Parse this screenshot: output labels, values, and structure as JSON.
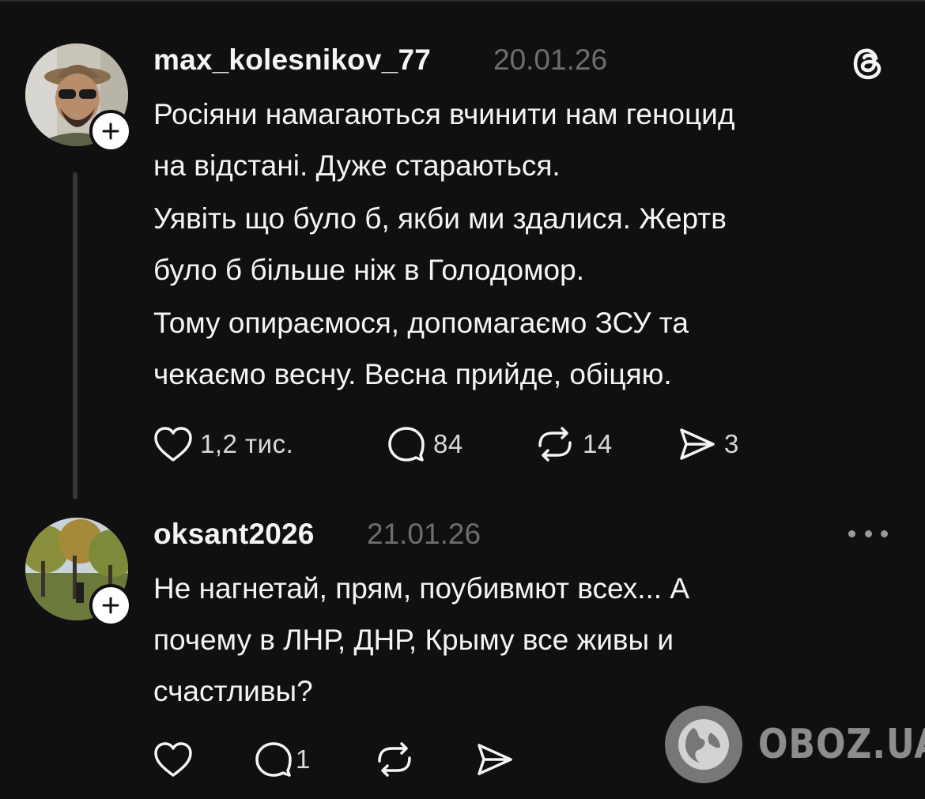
{
  "post1": {
    "username": "max_kolesnikov_77",
    "date": "20.01.26",
    "lines": [
      "Росіяни намагаються вчинити нам геноцид",
      "на відстані. Дуже стараються.",
      "Уявіть що було б, якби ми здалися. Жертв",
      "було б більше ніж в Голодомор.",
      "Тому опираємося, допомагаємо ЗСУ та",
      "чекаємо весну. Весна прийде, обіцяю."
    ],
    "likes": "1,2 тис.",
    "comments": "84",
    "reposts": "14",
    "shares": "3"
  },
  "post2": {
    "username": "oksant2026",
    "date": "21.01.26",
    "lines": [
      "Не нагнетай, прям, поубивмют всех... А",
      "почему в ЛНР, ДНР, Крыму все живы и",
      "счастливы?"
    ],
    "comments": "1"
  },
  "watermark": {
    "text": "OBOZ.UA"
  },
  "icons": {
    "header": "threads-logo-icon",
    "menu": "more-options-icon"
  },
  "colors": {
    "background": "#101010",
    "text": "#f3f5f7",
    "muted": "#6e6e6e"
  }
}
